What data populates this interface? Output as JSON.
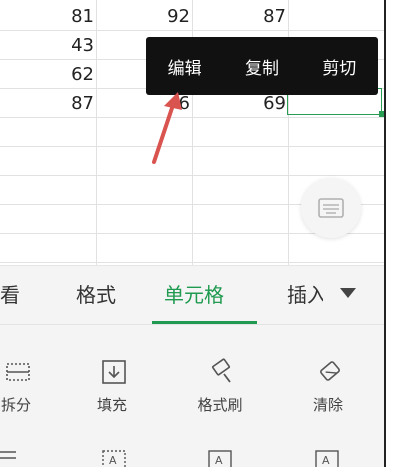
{
  "grid": {
    "rows": [
      [
        "81",
        "92",
        "87"
      ],
      [
        "43",
        "",
        ""
      ],
      [
        "62",
        "",
        ""
      ],
      [
        "87",
        "6",
        "69"
      ]
    ]
  },
  "context_menu": {
    "items": [
      "编辑",
      "复制",
      "剪切"
    ]
  },
  "toolbar": {
    "tabs": [
      "看",
      "格式",
      "单元格",
      "插入"
    ],
    "active_tab": "单元格",
    "tools_row1": [
      "拆分",
      "填充",
      "格式刷",
      "清除"
    ]
  },
  "colors": {
    "accent": "#1f9a50",
    "selection": "#2a9d55",
    "menu_bg": "#111111",
    "arrow": "#d9534f"
  }
}
